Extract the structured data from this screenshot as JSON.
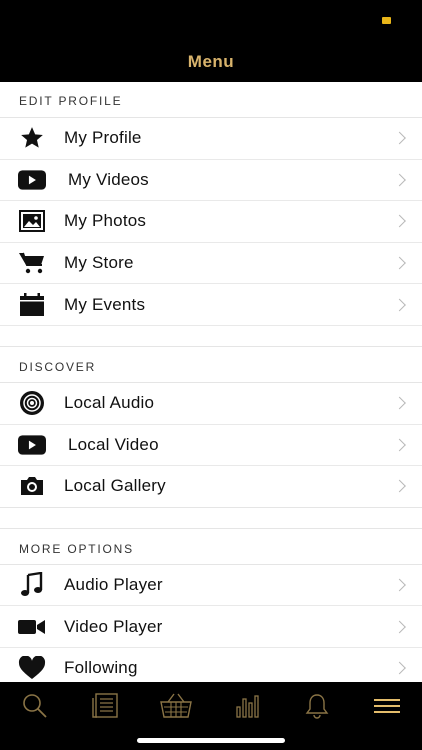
{
  "header": {
    "title": "Menu"
  },
  "sections": {
    "edit_profile": {
      "title": "EDIT PROFILE",
      "items": [
        {
          "label": "My Profile",
          "icon": "star-icon"
        },
        {
          "label": "My Videos",
          "icon": "play-button-icon"
        },
        {
          "label": "My Photos",
          "icon": "photo-icon"
        },
        {
          "label": "My Store",
          "icon": "cart-icon"
        },
        {
          "label": "My Events",
          "icon": "calendar-icon"
        }
      ]
    },
    "discover": {
      "title": "DISCOVER",
      "items": [
        {
          "label": "Local Audio",
          "icon": "speaker-icon"
        },
        {
          "label": "Local Video",
          "icon": "play-button-icon"
        },
        {
          "label": "Local Gallery",
          "icon": "camera-icon"
        }
      ]
    },
    "more_options": {
      "title": "MORE OPTIONS",
      "items": [
        {
          "label": "Audio Player",
          "icon": "music-note-icon"
        },
        {
          "label": "Video Player",
          "icon": "video-camera-icon"
        },
        {
          "label": "Following",
          "icon": "heart-icon"
        }
      ]
    }
  },
  "tabbar": {
    "tabs": [
      "search-icon",
      "news-icon",
      "basket-icon",
      "chart-icon",
      "bell-icon",
      "menu-icon"
    ],
    "active": "menu-icon"
  },
  "colors": {
    "accent": "#d8b36c",
    "header_bg": "#000000",
    "status_dot": "#e9b619"
  }
}
